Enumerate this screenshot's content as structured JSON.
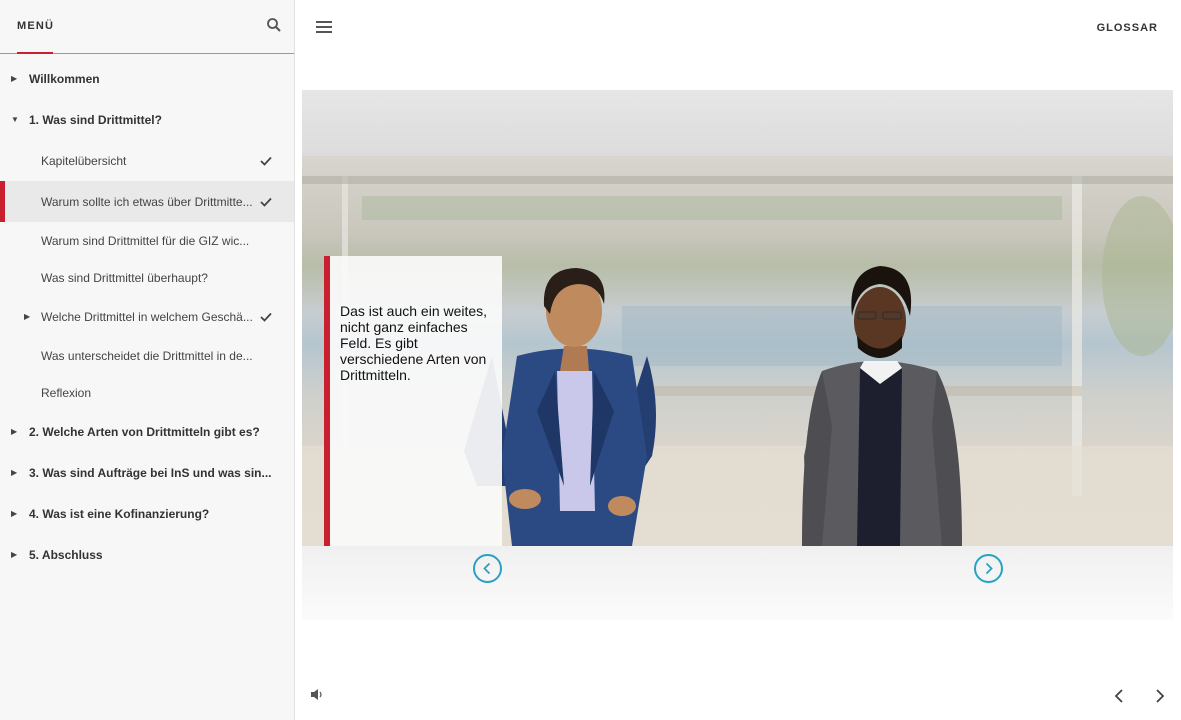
{
  "sidebar": {
    "tab_label": "MENÜ",
    "items": [
      {
        "label": "Willkommen",
        "level": "top",
        "caret": "right",
        "checked": false,
        "active": false
      },
      {
        "label": "1. Was sind Drittmittel?",
        "level": "top",
        "caret": "down",
        "checked": false,
        "active": false
      },
      {
        "label": "Kapitelübersicht",
        "level": "sub",
        "caret": "",
        "checked": true,
        "active": false
      },
      {
        "label": "Warum sollte ich etwas über Drittmitte...",
        "level": "sub",
        "caret": "",
        "checked": true,
        "active": true
      },
      {
        "label": "Warum sind Drittmittel für die GIZ wic...",
        "level": "sub",
        "caret": "",
        "checked": false,
        "active": false
      },
      {
        "label": "Was sind Drittmittel überhaupt?",
        "level": "sub",
        "caret": "",
        "checked": false,
        "active": false
      },
      {
        "label": "Welche Drittmittel in welchem Geschä...",
        "level": "sub",
        "caret": "right",
        "checked": true,
        "active": false
      },
      {
        "label": "Was unterscheidet die Drittmittel in de...",
        "level": "sub",
        "caret": "",
        "checked": false,
        "active": false
      },
      {
        "label": "Reflexion",
        "level": "sub",
        "caret": "",
        "checked": false,
        "active": false
      },
      {
        "label": "2. Welche Arten von Drittmitteln gibt es?",
        "level": "top",
        "caret": "right",
        "checked": false,
        "active": false
      },
      {
        "label": "3. Was sind Aufträge bei InS und was sin...",
        "level": "top",
        "caret": "right",
        "checked": false,
        "active": false
      },
      {
        "label": "4. Was ist eine Kofinanzierung?",
        "level": "top",
        "caret": "right",
        "checked": false,
        "active": false
      },
      {
        "label": "5. Abschluss",
        "level": "top",
        "caret": "right",
        "checked": false,
        "active": false
      }
    ]
  },
  "header": {
    "glossar_label": "GLOSSAR"
  },
  "slide": {
    "caption": "Das ist auch ein weites, nicht ganz einfaches Feld. Es gibt verschiedene Arten von Drittmitteln."
  },
  "colors": {
    "accent_red": "#c8202e",
    "nav_teal": "#2aa1c0"
  },
  "icons": {
    "search": "search-icon",
    "hamburger": "hamburger-menu-icon",
    "check": "checkmark-icon",
    "speaker": "speaker-icon",
    "prev": "chevron-left-icon",
    "next": "chevron-right-icon"
  }
}
